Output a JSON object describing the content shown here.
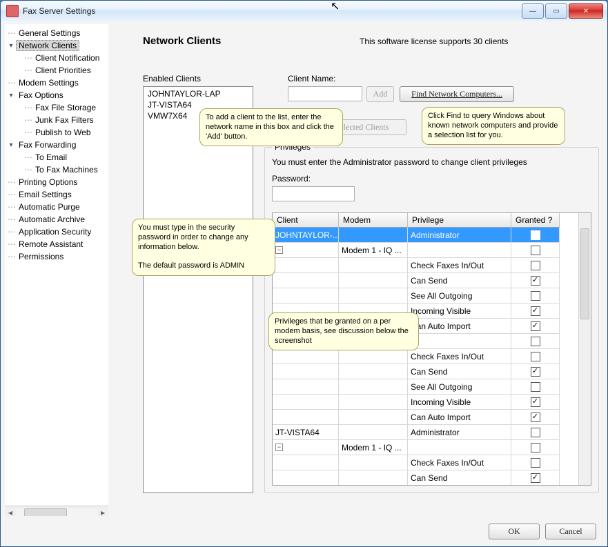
{
  "window": {
    "title": "Fax Server Settings"
  },
  "sidebar": {
    "items": [
      {
        "label": "General Settings",
        "expand": "",
        "indent": 0
      },
      {
        "label": "Network Clients",
        "expand": "▾",
        "indent": 0,
        "selected": true
      },
      {
        "label": "Client Notification",
        "expand": "",
        "indent": 1
      },
      {
        "label": "Client Priorities",
        "expand": "",
        "indent": 1
      },
      {
        "label": "Modem Settings",
        "expand": "",
        "indent": 0
      },
      {
        "label": "Fax Options",
        "expand": "▾",
        "indent": 0
      },
      {
        "label": "Fax File Storage",
        "expand": "",
        "indent": 1
      },
      {
        "label": "Junk Fax Filters",
        "expand": "",
        "indent": 1
      },
      {
        "label": "Publish to Web",
        "expand": "",
        "indent": 1
      },
      {
        "label": "Fax Forwarding",
        "expand": "▾",
        "indent": 0
      },
      {
        "label": "To Email",
        "expand": "",
        "indent": 1
      },
      {
        "label": "To Fax Machines",
        "expand": "",
        "indent": 1
      },
      {
        "label": "Printing Options",
        "expand": "",
        "indent": 0
      },
      {
        "label": "Email Settings",
        "expand": "",
        "indent": 0
      },
      {
        "label": "Automatic Purge",
        "expand": "",
        "indent": 0
      },
      {
        "label": "Automatic Archive",
        "expand": "",
        "indent": 0
      },
      {
        "label": "Application Security",
        "expand": "",
        "indent": 0
      },
      {
        "label": "Remote Assistant",
        "expand": "",
        "indent": 0
      },
      {
        "label": "Permissions",
        "expand": "",
        "indent": 0
      }
    ]
  },
  "page": {
    "heading": "Network Clients",
    "license_text": "This software license supports 30 clients",
    "enabled_clients_label": "Enabled Clients",
    "enabled_clients": [
      "JOHNTAYLOR-LAP",
      "JT-VISTA64",
      "VMW7X64"
    ],
    "client_name_label": "Client Name:",
    "client_name_value": "",
    "add_label": "Add",
    "find_label": "Find Network Computers...",
    "remove_label": "Remove Selected Clients",
    "privileges": {
      "legend": "Privileges",
      "instruction": "You must enter the Administrator password to change client privileges",
      "password_label": "Password:",
      "password_value": "",
      "columns": [
        "Client",
        "Modem",
        "Privilege",
        "Granted ?"
      ],
      "rows": [
        {
          "client": "JOHNTAYLOR-...",
          "modem": "",
          "priv": "Administrator",
          "granted": false,
          "expand": "",
          "selected": true
        },
        {
          "client": "",
          "modem": "Modem 1 - IQ ...",
          "priv": "",
          "granted": false,
          "expand": "-"
        },
        {
          "client": "",
          "modem": "",
          "priv": "Check Faxes In/Out",
          "granted": false
        },
        {
          "client": "",
          "modem": "",
          "priv": "Can Send",
          "granted": true
        },
        {
          "client": "",
          "modem": "",
          "priv": "See All Outgoing",
          "granted": false
        },
        {
          "client": "",
          "modem": "",
          "priv": "Incoming Visible",
          "granted": true
        },
        {
          "client": "",
          "modem": "",
          "priv": "Can Auto Import",
          "granted": true
        },
        {
          "client": "",
          "modem": "",
          "priv": "",
          "granted": false
        },
        {
          "client": "",
          "modem": "",
          "priv": "Check Faxes In/Out",
          "granted": false
        },
        {
          "client": "",
          "modem": "",
          "priv": "Can Send",
          "granted": true
        },
        {
          "client": "",
          "modem": "",
          "priv": "See All Outgoing",
          "granted": false
        },
        {
          "client": "",
          "modem": "",
          "priv": "Incoming Visible",
          "granted": true
        },
        {
          "client": "",
          "modem": "",
          "priv": "Can Auto Import",
          "granted": true
        },
        {
          "client": "JT-VISTA64",
          "modem": "",
          "priv": "Administrator",
          "granted": false
        },
        {
          "client": "",
          "modem": "Modem 1 - IQ ...",
          "priv": "",
          "granted": false,
          "expand": "-"
        },
        {
          "client": "",
          "modem": "",
          "priv": "Check Faxes In/Out",
          "granted": false
        },
        {
          "client": "",
          "modem": "",
          "priv": "Can Send",
          "granted": true
        }
      ]
    }
  },
  "callouts": {
    "add": "To add a client to the list, enter the network name in this box and click the 'Add' button.",
    "find": "Click Find to query Windows about known network computers and provide a selection list for you.",
    "password": "You must type in the security password in order to change any information below.\n\nThe default password is ADMIN",
    "grid": "Privileges that be granted on a per modem basis, see discussion below the screenshot"
  },
  "footer": {
    "ok": "OK",
    "cancel": "Cancel"
  }
}
